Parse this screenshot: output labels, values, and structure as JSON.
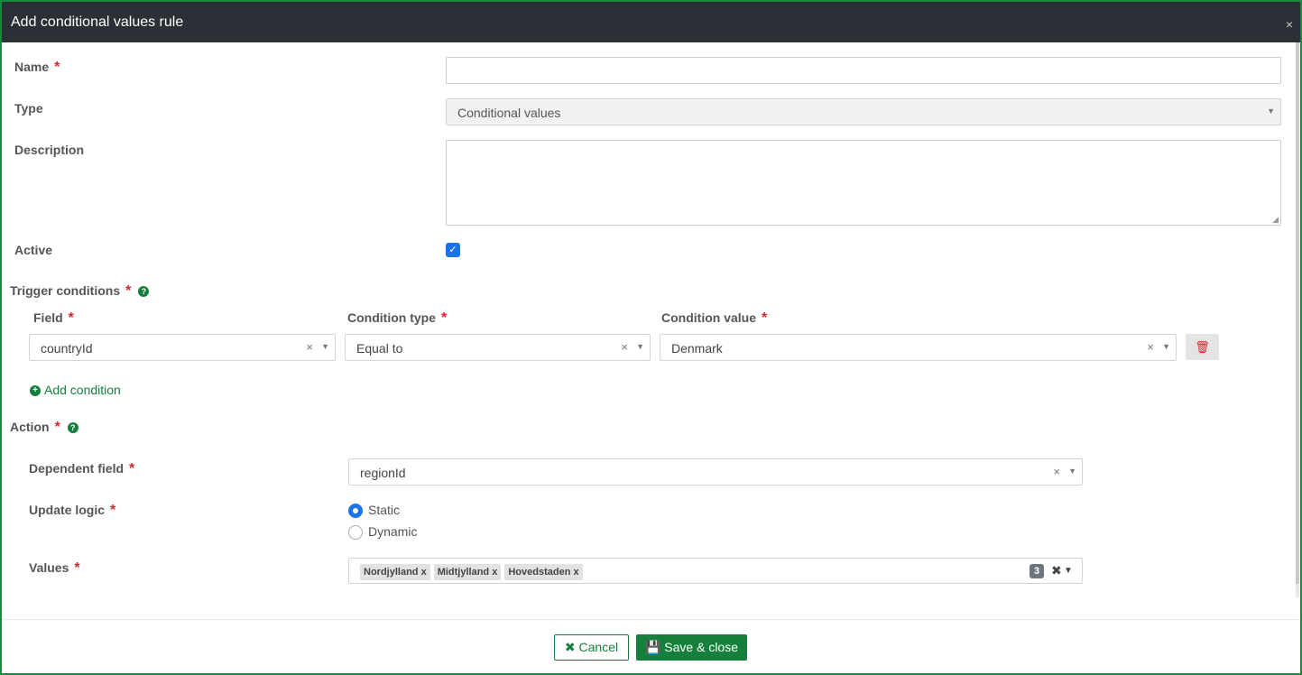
{
  "modal": {
    "title": "Add conditional values rule",
    "close_glyph": "×"
  },
  "form": {
    "name_label": "Name",
    "type_label": "Type",
    "type_value": "Conditional values",
    "description_label": "Description",
    "active_label": "Active",
    "active_checked": true
  },
  "trigger": {
    "label": "Trigger conditions",
    "field_label": "Field",
    "condition_type_label": "Condition type",
    "condition_value_label": "Condition value",
    "field_value": "countryId",
    "condition_type_value": "Equal to",
    "condition_value": "Denmark",
    "add_condition_label": "Add condition"
  },
  "action": {
    "label": "Action",
    "dependent_field_label": "Dependent field",
    "dependent_field_value": "regionId",
    "update_logic_label": "Update logic",
    "update_logic_options": [
      "Static",
      "Dynamic"
    ],
    "update_logic_selected": "Static",
    "values_label": "Values",
    "values_tags": [
      "Nordjylland",
      "Midtjylland",
      "Hovedstaden"
    ],
    "values_count": "3"
  },
  "footer": {
    "cancel_label": "Cancel",
    "save_label": "Save & close"
  },
  "colors": {
    "accent": "#14803c",
    "header": "#2c2f36",
    "required": "#d9232e",
    "checkbox": "#1a73e8"
  }
}
